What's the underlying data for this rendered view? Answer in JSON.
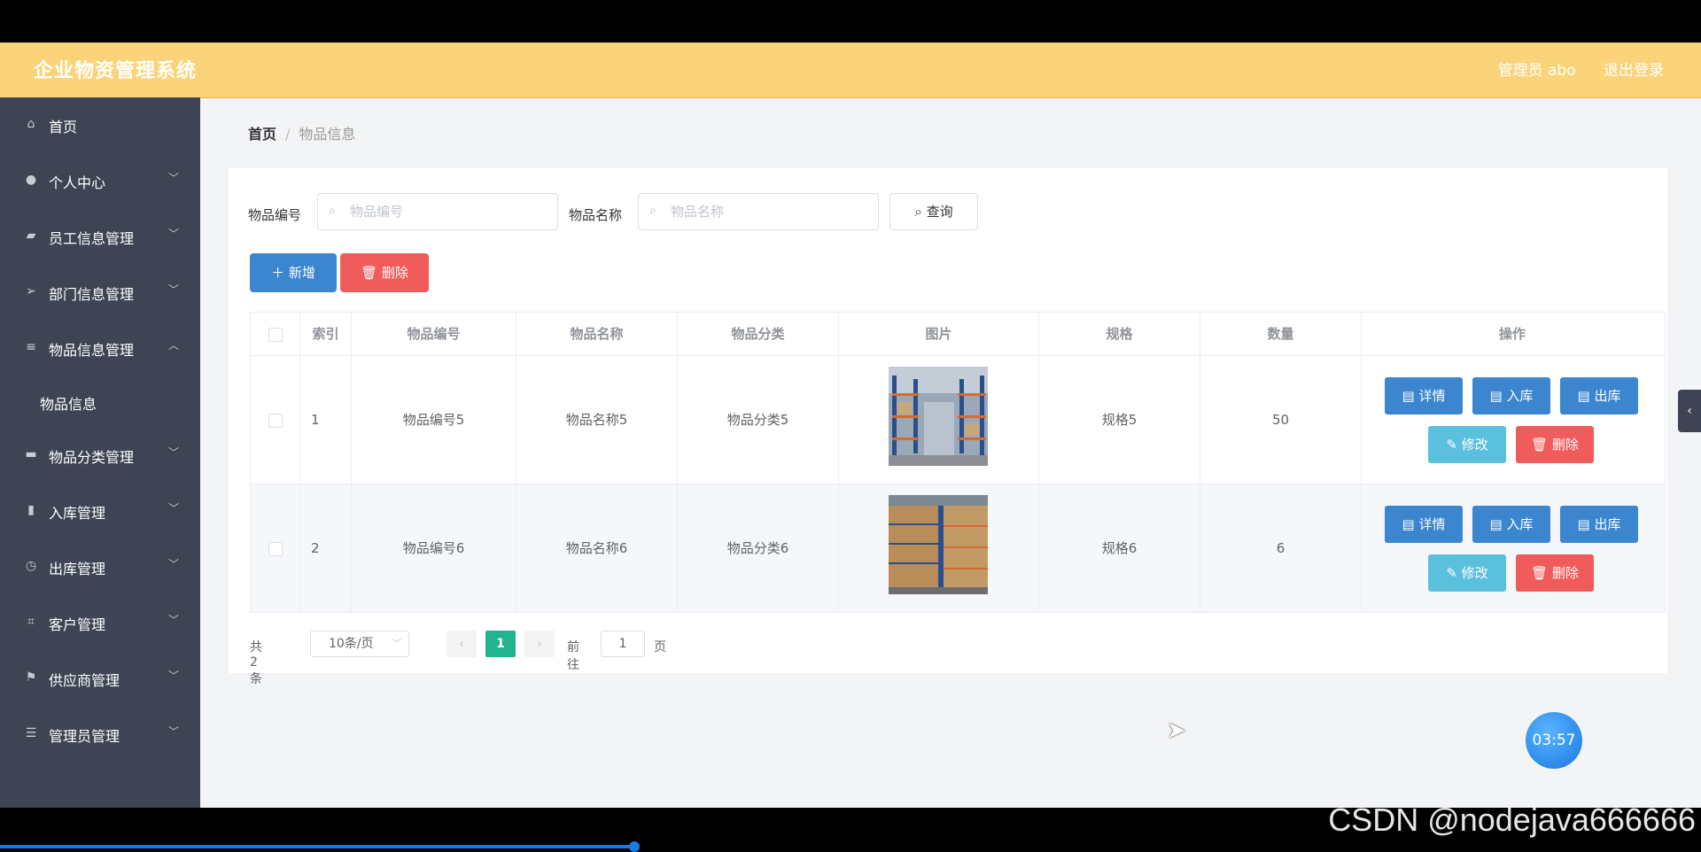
{
  "app": {
    "title": "企业物资管理系统",
    "admin_label": "管理员 abo",
    "logout_label": "退出登录"
  },
  "sidebar": {
    "items": [
      {
        "label": "首页",
        "icon": "home-icon",
        "has_arrow": false
      },
      {
        "label": "个人中心",
        "icon": "user-icon",
        "has_arrow": true
      },
      {
        "label": "员工信息管理",
        "icon": "briefcase-icon",
        "has_arrow": true
      },
      {
        "label": "部门信息管理",
        "icon": "send-icon",
        "has_arrow": true
      },
      {
        "label": "物品信息管理",
        "icon": "list-icon",
        "has_arrow": true,
        "expanded": true
      },
      {
        "label": "物品分类管理",
        "icon": "monitor-icon",
        "has_arrow": true
      },
      {
        "label": "入库管理",
        "icon": "bar-chart-icon",
        "has_arrow": true
      },
      {
        "label": "出库管理",
        "icon": "clock-icon",
        "has_arrow": true
      },
      {
        "label": "客户管理",
        "icon": "crop-icon",
        "has_arrow": true
      },
      {
        "label": "供应商管理",
        "icon": "flag-icon",
        "has_arrow": true
      },
      {
        "label": "管理员管理",
        "icon": "sliders-icon",
        "has_arrow": true
      }
    ],
    "sub_item": "物品信息"
  },
  "breadcrumb": {
    "home": "首页",
    "separator": "/",
    "current": "物品信息"
  },
  "filters": {
    "code_label": "物品编号",
    "code_placeholder": "物品编号",
    "name_label": "物品名称",
    "name_placeholder": "物品名称",
    "query_label": "查询"
  },
  "actions": {
    "add_label": "新增",
    "delete_label": "删除"
  },
  "table": {
    "columns": [
      "索引",
      "物品编号",
      "物品名称",
      "物品分类",
      "图片",
      "规格",
      "数量",
      "操作"
    ],
    "rows": [
      {
        "index": "1",
        "code": "物品编号5",
        "name": "物品名称5",
        "category": "物品分类5",
        "spec": "规格5",
        "qty": "50"
      },
      {
        "index": "2",
        "code": "物品编号6",
        "name": "物品名称6",
        "category": "物品分类6",
        "spec": "规格6",
        "qty": "6"
      }
    ],
    "row_actions": {
      "detail": "详情",
      "stock_in": "入库",
      "stock_out": "出库",
      "edit": "修改",
      "delete": "删除"
    }
  },
  "pagination": {
    "total": "共 2 条",
    "page_size": "10条/页",
    "current_page": "1",
    "goto_label": "前往",
    "goto_value": "1",
    "page_suffix": "页"
  },
  "overlay": {
    "timer": "03:57",
    "watermark": "CSDN @nodejava666666"
  },
  "colors": {
    "header": "#fbd479",
    "sidebar": "#3e4454",
    "primary": "#3c86d0",
    "danger": "#f05c5c",
    "info": "#5bc0de",
    "pager_active": "#22b28e"
  }
}
